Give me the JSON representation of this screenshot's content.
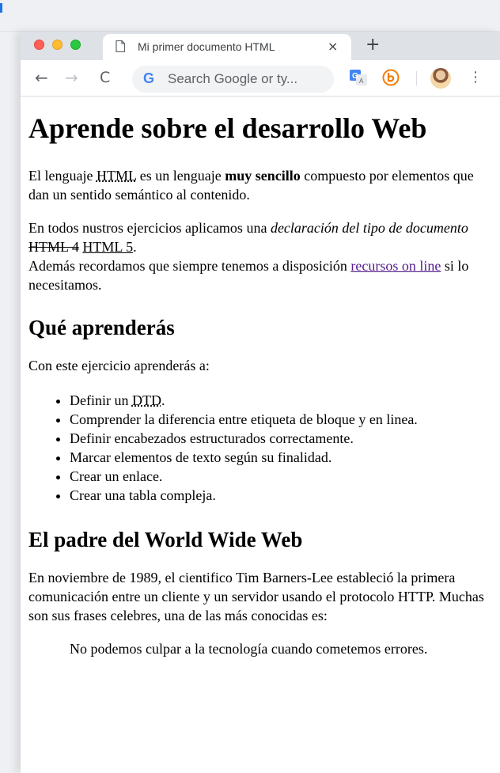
{
  "browser": {
    "tab_title": "Mi primer documento HTML",
    "tab_close": "×",
    "new_tab": "+",
    "omnibox_placeholder": "Search Google or ty...",
    "omnibox_g": "G",
    "back": "←",
    "forward": "→",
    "reload": "C",
    "menu": "⋮"
  },
  "colors": {
    "link": "#551a8b",
    "traffic_red": "#ff5f57",
    "traffic_yellow": "#febc2e",
    "traffic_green": "#28c840"
  },
  "icons": {
    "tab": "document-icon",
    "translate": "google-translate-icon",
    "extension": "b-extension-icon",
    "profile": "avatar"
  },
  "page": {
    "h1": "Aprende sobre el desarrollo Web",
    "p1": {
      "t1": "El lenguaje ",
      "abbr": "HTML",
      "t2": " es un lenguaje ",
      "strong": "muy sencillo",
      "t3": " compuesto por elementos que dan un sentido semántico al contenido."
    },
    "p2": {
      "t1": "En todos nustros ejercicios aplicamos una ",
      "em": "declaración del tipo de documento",
      "t2": " ",
      "del": "HTML 4",
      "t3": " ",
      "ins": "HTML 5",
      "t4": ".",
      "t5": "Además recordamos que siempre tenemos a disposición ",
      "link": "recursos on line",
      "t6": " si lo necesitamos."
    },
    "h2_learn": "Qué aprenderás",
    "learn_intro": "Con este ejercicio aprenderás a:",
    "list": {
      "item1_a": "Definir un ",
      "item1_abbr": "DTD",
      "item1_b": ".",
      "item2": "Comprender la diferencia entre etiqueta de bloque y en linea.",
      "item3": "Definir encabezados estructurados correctamente.",
      "item4": "Marcar elementos de texto según su finalidad.",
      "item5": "Crear un enlace.",
      "item6": "Crear una tabla compleja."
    },
    "h2_father": "El padre del World Wide Web",
    "p_father": "En noviembre de 1989, el cientifico Tim Barners-Lee estableció la primera comunicación entre un cliente y un servidor usando el protocolo HTTP. Muchas son sus frases celebres, una de las más conocidas es:",
    "quote": "No podemos culpar a la tecnología cuando cometemos errores."
  }
}
